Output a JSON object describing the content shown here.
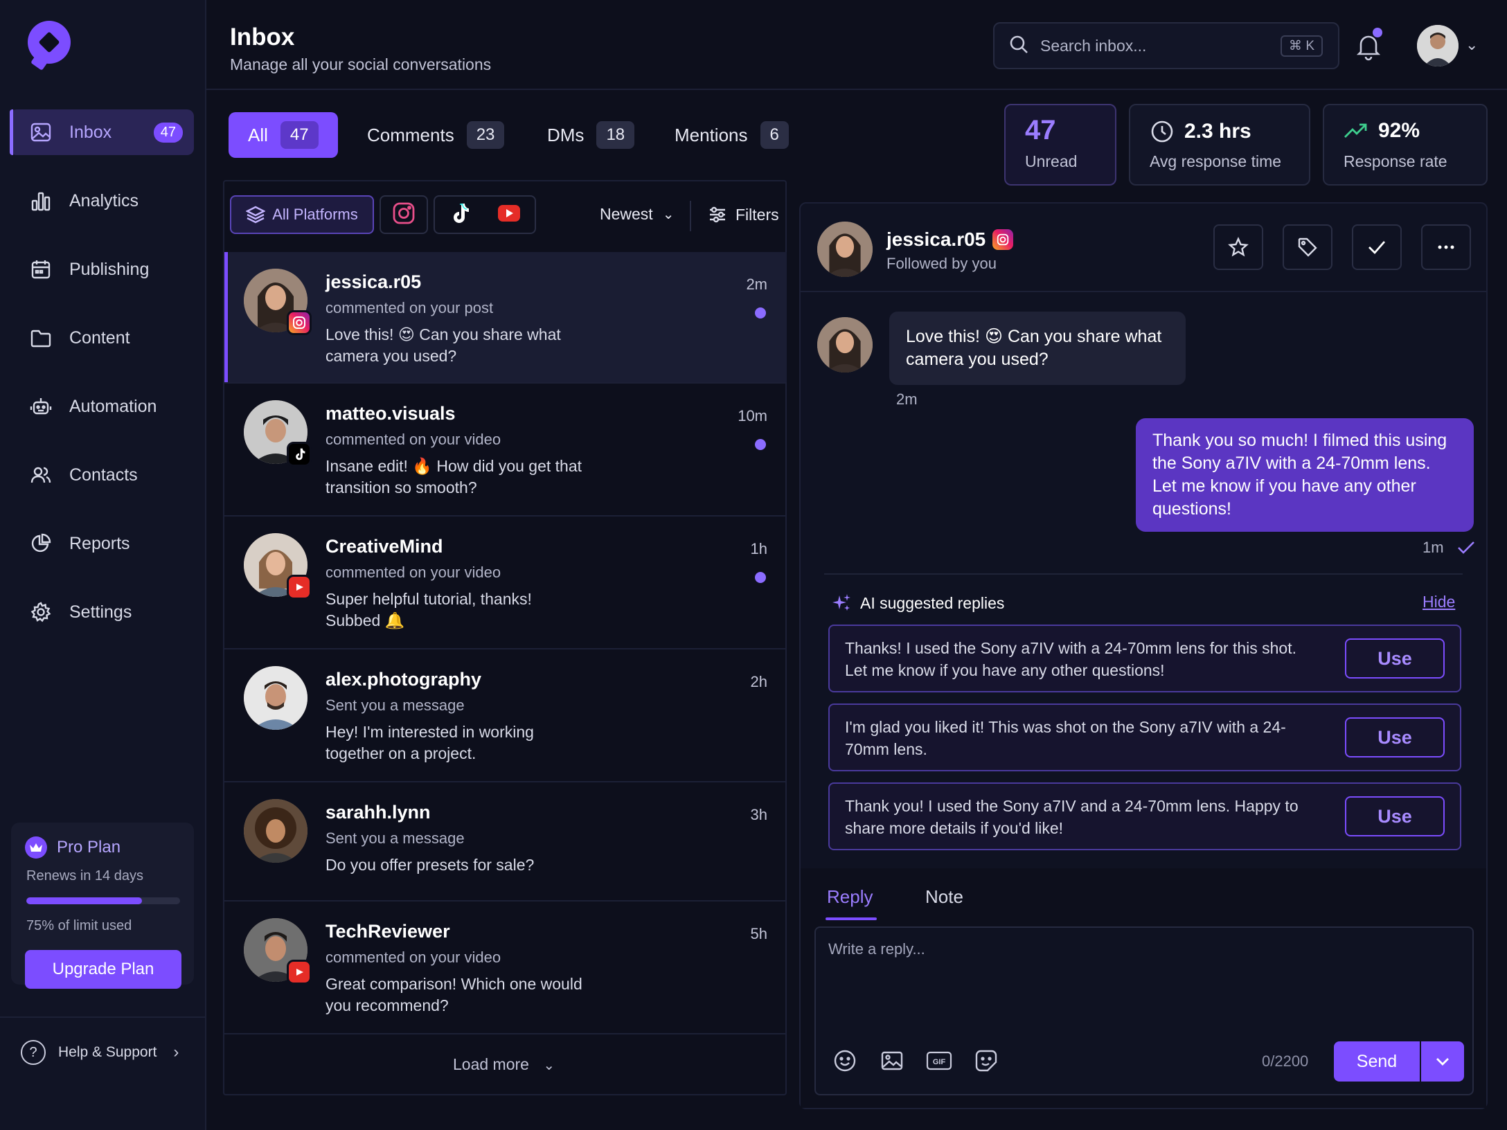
{
  "header": {
    "title": "Inbox",
    "subtitle": "Manage all your social conversations",
    "search_placeholder": "Search inbox...",
    "search_shortcut": "⌘ K"
  },
  "sidebar": {
    "items": [
      {
        "label": "Inbox",
        "icon": "image-icon",
        "badge": "47",
        "active": true
      },
      {
        "label": "Analytics",
        "icon": "bar-chart-icon"
      },
      {
        "label": "Publishing",
        "icon": "calendar-icon"
      },
      {
        "label": "Content",
        "icon": "folder-icon"
      },
      {
        "label": "Automation",
        "icon": "robot-icon"
      },
      {
        "label": "Contacts",
        "icon": "users-icon"
      },
      {
        "label": "Reports",
        "icon": "pie-chart-icon"
      },
      {
        "label": "Settings",
        "icon": "gear-icon"
      }
    ],
    "plan": {
      "title": "Pro Plan",
      "renews": "Renews in 14 days",
      "usage_label": "75% of limit used",
      "usage_fraction": 0.75,
      "upgrade_label": "Upgrade Plan"
    },
    "help_label": "Help & Support"
  },
  "tabs": [
    {
      "label": "All",
      "count": "47",
      "active": true
    },
    {
      "label": "Comments",
      "count": "23"
    },
    {
      "label": "DMs",
      "count": "18"
    },
    {
      "label": "Mentions",
      "count": "6"
    }
  ],
  "stats": [
    {
      "value": "47",
      "label": "Unread"
    },
    {
      "value": "2.3 hrs",
      "label": "Avg response time"
    },
    {
      "value": "92%",
      "label": "Response rate"
    }
  ],
  "filters": {
    "platform_all": "All Platforms",
    "sort_label": "Newest",
    "filters_label": "Filters"
  },
  "conversations": [
    {
      "name": "jessica.r05",
      "platform": "instagram",
      "action": "commented on your post",
      "message": "Love this! 😍 Can you share what camera you used?",
      "time": "2m",
      "unread": true
    },
    {
      "name": "matteo.visuals",
      "platform": "tiktok",
      "action": "commented on your video",
      "message": "Insane edit! 🔥 How did you get that transition so smooth?",
      "time": "10m",
      "unread": true
    },
    {
      "name": "CreativeMind",
      "platform": "youtube",
      "action": "commented on your video",
      "message": "Super helpful tutorial, thanks! Subbed 🔔",
      "time": "1h",
      "unread": true
    },
    {
      "name": "alex.photography",
      "platform": "none",
      "action": "Sent you a message",
      "message": "Hey! I'm interested in working together on a project.",
      "time": "2h",
      "unread": false
    },
    {
      "name": "sarahh.lynn",
      "platform": "none",
      "action": "Sent you a message",
      "message": "Do you offer presets for sale?",
      "time": "3h",
      "unread": false
    },
    {
      "name": "TechReviewer",
      "platform": "youtube",
      "action": "commented on your video",
      "message": "Great comparison! Which one would you recommend?",
      "time": "5h",
      "unread": false
    }
  ],
  "load_more": "Load more",
  "detail": {
    "name": "jessica.r05",
    "followed": "Followed by you",
    "incoming": "Love this! 😍 Can you share what camera you used?",
    "incoming_time": "2m",
    "outgoing": "Thank you so much! I filmed this using the Sony a7IV with a 24-70mm lens. Let me know if you have any other questions!",
    "outgoing_time": "1m",
    "ai_title": "AI suggested replies",
    "ai_hide": "Hide",
    "suggestions": [
      {
        "text": "Thanks! I used the Sony a7IV with a 24-70mm lens for this shot. Let me know if you have any other questions!",
        "button": "Use"
      },
      {
        "text": "I'm glad you liked it! This was shot on the Sony a7IV with a 24-70mm lens.",
        "button": "Use"
      },
      {
        "text": "Thank you! I used the Sony a7IV and a 24-70mm lens. Happy to share more details if you'd like!",
        "button": "Use"
      }
    ],
    "reply_tab": "Reply",
    "note_tab": "Note",
    "reply_placeholder": "Write a reply...",
    "counter": "0/2200",
    "send_label": "Send"
  },
  "colors": {
    "accent": "#7c4dff",
    "background": "#0d0f1c",
    "sidebar": "#111425"
  }
}
